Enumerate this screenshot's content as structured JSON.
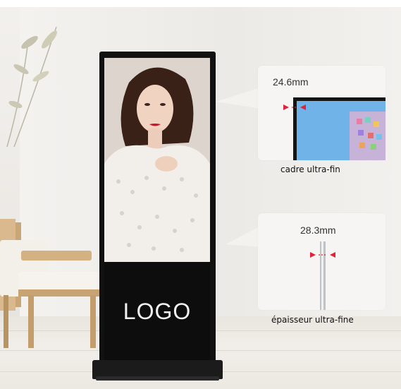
{
  "kiosk": {
    "logo_text": "LOGO"
  },
  "callouts": [
    {
      "measurement": "24.6mm",
      "caption": "cadre ultra-fin"
    },
    {
      "measurement": "28.3mm",
      "caption": "épaisseur ultra-fine"
    }
  ],
  "colors": {
    "kiosk_frame": "#111111",
    "marker_red": "#e0233a",
    "wall": "#eceae6"
  }
}
